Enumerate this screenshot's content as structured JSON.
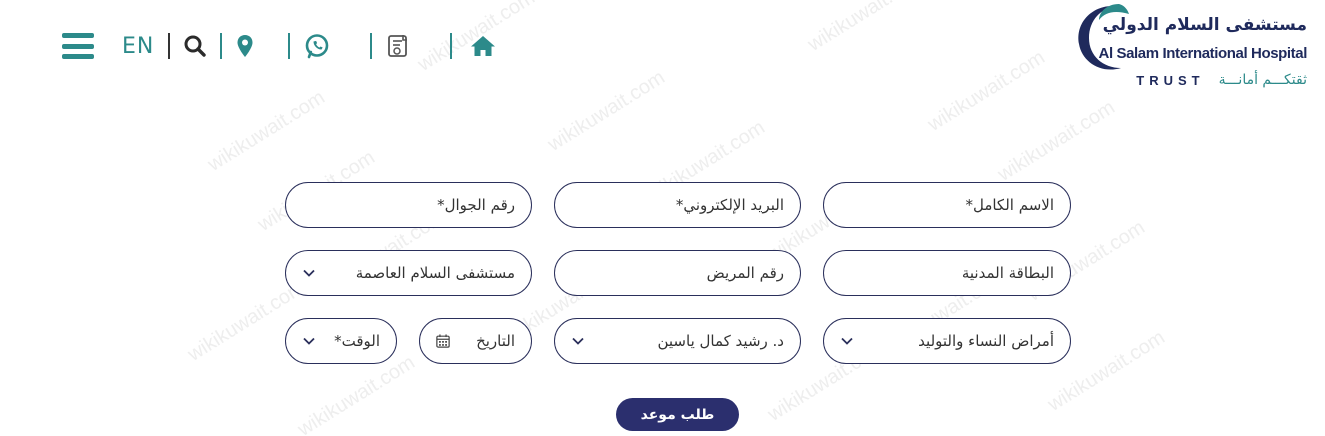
{
  "header": {
    "language_label": "EN",
    "icons": [
      "menu-icon",
      "search-icon",
      "location-pin-icon",
      "whatsapp-icon",
      "appointment-card-icon",
      "home-icon"
    ]
  },
  "logo": {
    "arabic_name": "مستشفى السلام الدولي",
    "english_name": "Al Salam International Hospital",
    "tagline_en": "TRUST",
    "tagline_ar": "ثقتكـــم أمانـــة"
  },
  "watermark": "wikikuwait.com",
  "form": {
    "full_name": "الاسم الكامل*",
    "email": "البريد الإلكتروني*",
    "mobile": "رقم الجوال*",
    "civil_id": "البطاقة المدنية",
    "patient_number": "رقم المريض",
    "hospital_select": "مستشفى السلام العاصمة",
    "department_select": "أمراض النساء والتوليد",
    "doctor_select": "د. رشيد كمال ياسين",
    "date": "التاريخ",
    "time_select": "الوقت*",
    "submit_label": "طلب موعد"
  },
  "colors": {
    "teal": "#2c8a8a",
    "navy": "#2b2f6e",
    "field_border": "#2a2f5b"
  }
}
